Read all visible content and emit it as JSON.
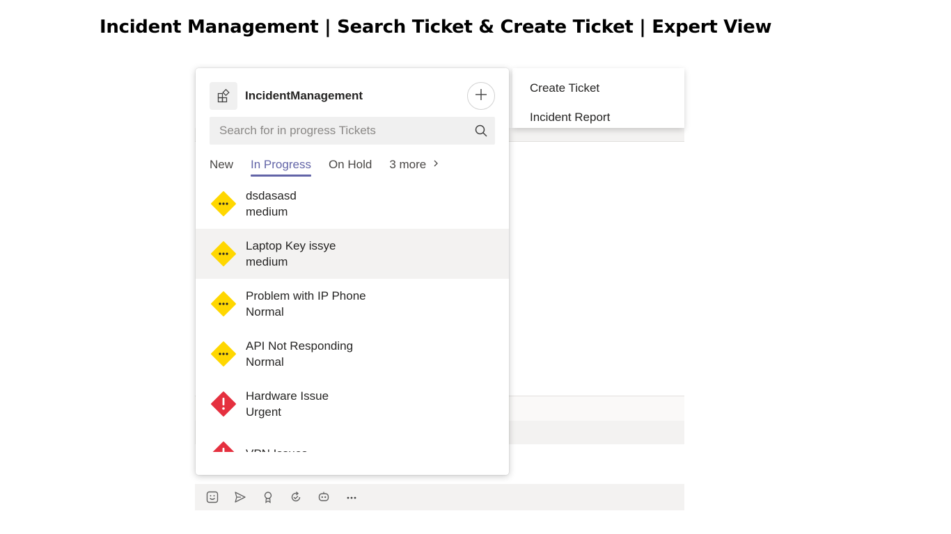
{
  "page": {
    "title": "Incident Management | Search Ticket & Create Ticket | Expert View"
  },
  "menu": {
    "items": [
      "Create Ticket",
      "Incident Report"
    ]
  },
  "panel": {
    "app_name": "IncidentManagement",
    "add_icon": "plus-icon",
    "search": {
      "placeholder": "Search for in progress Tickets",
      "value": ""
    },
    "tabs": [
      "New",
      "In Progress",
      "On Hold",
      "3 more"
    ],
    "active_tab": "In Progress",
    "tickets": [
      {
        "title": "dsdasasd",
        "priority": "medium",
        "icon": "pending-diamond-icon",
        "color": "#ffd700"
      },
      {
        "title": "Laptop Key issye",
        "priority": "medium",
        "icon": "pending-diamond-icon",
        "color": "#ffd700"
      },
      {
        "title": "Problem with IP Phone",
        "priority": "Normal",
        "icon": "pending-diamond-icon",
        "color": "#ffd700"
      },
      {
        "title": "API Not Responding",
        "priority": "Normal",
        "icon": "pending-diamond-icon",
        "color": "#ffd700"
      },
      {
        "title": "Hardware Issue",
        "priority": "Urgent",
        "icon": "alert-diamond-icon",
        "color": "#e5303f"
      },
      {
        "title": "VPN Issues",
        "priority": "",
        "icon": "alert-diamond-icon",
        "color": "#e5303f"
      }
    ]
  },
  "compose_toolbar": {
    "icons": [
      "sticker-icon",
      "send-icon",
      "praise-icon",
      "loop-icon",
      "bot-icon",
      "more-icon"
    ]
  },
  "colors": {
    "accent": "#6264a7",
    "hover_row": "#f3f2f1",
    "warning": "#ffd700",
    "urgent": "#e5303f"
  }
}
